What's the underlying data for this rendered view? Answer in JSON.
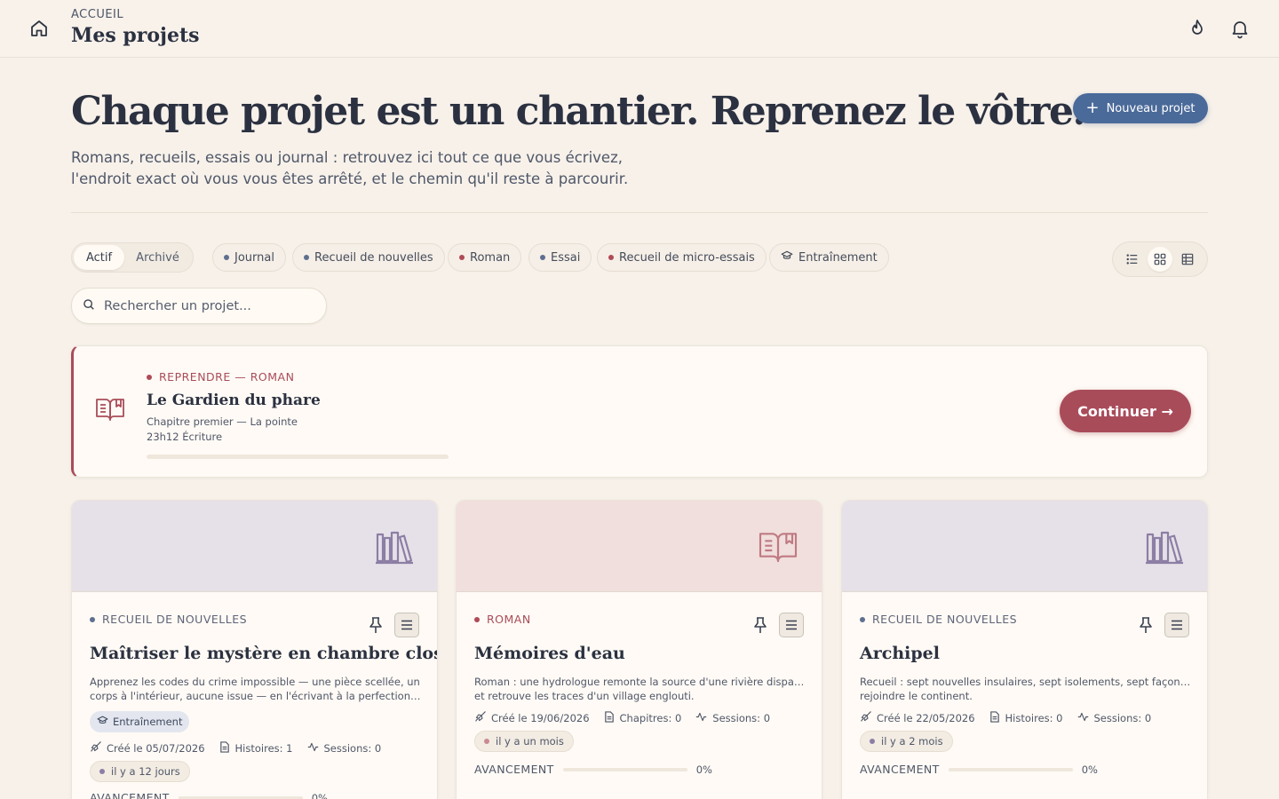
{
  "header": {
    "breadcrumb": "ACCUEIL",
    "title": "Mes projets",
    "icons": [
      "home-icon",
      "flame-icon",
      "bell-icon"
    ]
  },
  "hero": {
    "title": "Chaque projet est un chantier. Reprenez le vôtre.",
    "subtitle_line1": "Romans, recueils, essais ou journal : retrouvez ici tout ce que vous écrivez,",
    "subtitle_line2": "l'endroit exact où vous vous êtes arrêté, et le chemin qu'il reste à parcourir.",
    "new_button": "Nouveau projet"
  },
  "filters": {
    "status_active": "Actif",
    "status_archived": "Archivé",
    "chips": [
      {
        "label": "Journal",
        "icon": "dot"
      },
      {
        "label": "Recueil de nouvelles",
        "icon": "dot"
      },
      {
        "label": "Roman",
        "icon": "dot"
      },
      {
        "label": "Essai",
        "icon": "dot"
      },
      {
        "label": "Recueil de micro-essais",
        "icon": "dot"
      },
      {
        "label": "Entraînement",
        "icon": "graduation-cap-icon"
      }
    ],
    "views": [
      "list-view-icon",
      "grid-view-icon",
      "table-view-icon"
    ],
    "active_view": "grid"
  },
  "search": {
    "placeholder": "Rechercher un projet..."
  },
  "resume": {
    "kicker": "REPRENDRE — ROMAN",
    "title": "Le Gardien du phare",
    "chapter": "Chapitre premier — La pointe",
    "time": "23h12 Écriture",
    "progress": 0,
    "button": "Continuer →",
    "accent": "#a94c5a"
  },
  "projects": [
    {
      "genre": "RECUEIL DE NOUVELLES",
      "genre_color": "#5e6478",
      "cover_color": "#e6e1e8",
      "cover_icon": "library-books-icon",
      "title": "Maîtriser le mystère en chambre close",
      "desc_line1": "Apprenez les codes du crime impossible — une pièce scellée, un",
      "desc_line2": "corps à l'intérieur, aucune issue — en l'écrivant à la perfection, u...",
      "badge": "Entraînement",
      "created": "Créé le 05/07/2026",
      "count": "Histoires: 1",
      "sessions": "Sessions: 0",
      "ago": "il y a 12 jours",
      "progress_label": "AVANCEMENT",
      "progress": 0,
      "progress_text": "0%"
    },
    {
      "genre": "ROMAN",
      "genre_color": "#a94c5a",
      "cover_color": "#f0dfdc",
      "cover_icon": "open-book-icon",
      "title": "Mémoires d'eau",
      "desc_line1": "Roman : une hydrologue remonte la source d'une rivière disparue",
      "desc_line2": "et retrouve les traces d'un village englouti.",
      "created": "Créé le 19/06/2026",
      "count": "Chapitres: 0",
      "sessions": "Sessions: 0",
      "ago": "il y a un mois",
      "progress_label": "AVANCEMENT",
      "progress": 0,
      "progress_text": "0%"
    },
    {
      "genre": "RECUEIL DE NOUVELLES",
      "genre_color": "#5e6478",
      "cover_color": "#e6e1e8",
      "cover_icon": "library-books-icon",
      "title": "Archipel",
      "desc_line1": "Recueil : sept nouvelles insulaires, sept isolements, sept façons de",
      "desc_line2": "rejoindre le continent.",
      "created": "Créé le 22/05/2026",
      "count": "Histoires: 0",
      "sessions": "Sessions: 0",
      "ago": "il y a 2 mois",
      "progress_label": "AVANCEMENT",
      "progress": 0,
      "progress_text": "0%"
    }
  ]
}
